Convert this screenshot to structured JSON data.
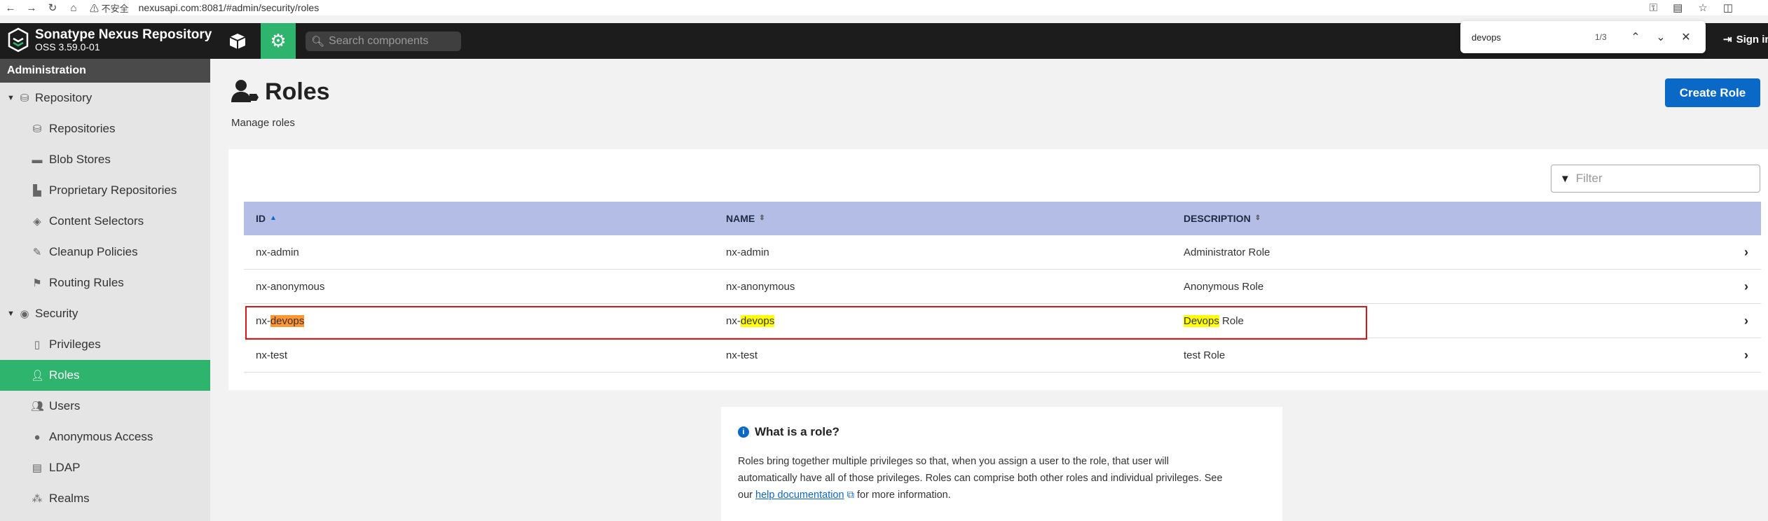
{
  "browser": {
    "warning": "不安全",
    "url": "nexusapi.com:8081/#admin/security/roles"
  },
  "header": {
    "brand_name": "Sonatype Nexus Repository",
    "brand_version": "OSS 3.59.0-01",
    "search_placeholder": "Search components",
    "signin": "Sign in"
  },
  "findbar": {
    "query": "devops",
    "count": "1/3"
  },
  "sidebar": {
    "section": "Administration",
    "items": [
      {
        "label": "Repository",
        "icon": "database-icon"
      },
      {
        "label": "Repositories",
        "icon": "database-icon"
      },
      {
        "label": "Blob Stores",
        "icon": "hdd-icon"
      },
      {
        "label": "Proprietary Repositories",
        "icon": "building-icon"
      },
      {
        "label": "Content Selectors",
        "icon": "layers-icon"
      },
      {
        "label": "Cleanup Policies",
        "icon": "brush-icon"
      },
      {
        "label": "Routing Rules",
        "icon": "signpost-icon"
      },
      {
        "label": "Security",
        "icon": "eye-icon"
      },
      {
        "label": "Privileges",
        "icon": "medal-icon"
      },
      {
        "label": "Roles",
        "icon": "user-tag-icon"
      },
      {
        "label": "Users",
        "icon": "users-icon"
      },
      {
        "label": "Anonymous Access",
        "icon": "user-icon"
      },
      {
        "label": "LDAP",
        "icon": "book-icon"
      },
      {
        "label": "Realms",
        "icon": "realms-icon"
      }
    ]
  },
  "page": {
    "title": "Roles",
    "subtitle": "Manage roles",
    "create_button": "Create Role",
    "filter_placeholder": "Filter"
  },
  "table": {
    "columns": [
      "ID",
      "NAME",
      "DESCRIPTION"
    ],
    "rows": [
      {
        "id": "nx-admin",
        "name": "nx-admin",
        "description": "Administrator Role"
      },
      {
        "id": "nx-anonymous",
        "name": "nx-anonymous",
        "description": "Anonymous Role"
      },
      {
        "id_prefix": "nx-",
        "id_match": "devops",
        "name_prefix": "nx-",
        "name_match": "devops",
        "desc_match": "Devops",
        "desc_suffix": " Role"
      },
      {
        "id": "nx-test",
        "name": "nx-test",
        "description": "test Role"
      }
    ]
  },
  "info": {
    "title": "What is a role?",
    "line1": "Roles bring together multiple privileges so that, when you assign a user to the role, that user will",
    "line2": "automatically have all of those privileges. Roles can comprise both other roles and individual privileges. See",
    "line3_pre": "our ",
    "link": "help documentation",
    "line3_post": " for more information."
  },
  "colors": {
    "accent": "#2fb46e",
    "primary": "#0a68c7",
    "header_bg": "#1c1c1c",
    "table_head": "#b3bde6",
    "find_current": "#ff9632",
    "find_match": "#ffff00",
    "annotation": "#d9161c"
  }
}
